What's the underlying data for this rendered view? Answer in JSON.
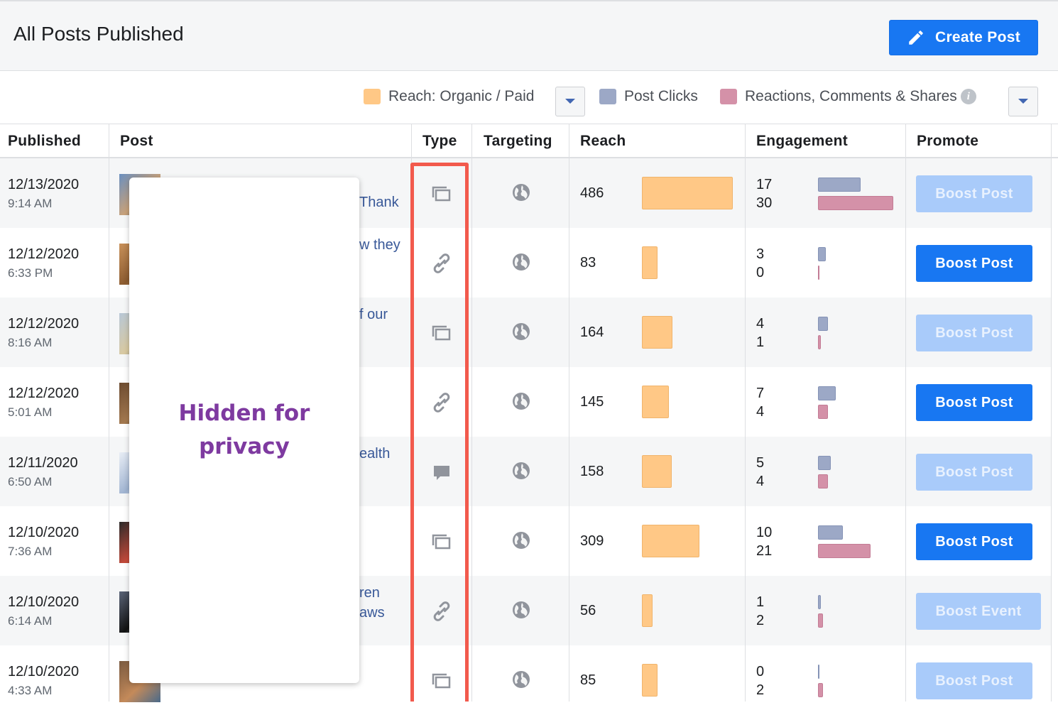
{
  "header": {
    "title": "All Posts Published",
    "create_label": "Create Post"
  },
  "legend": {
    "reach_label": "Reach: Organic / Paid",
    "clicks_label": "Post Clicks",
    "reactions_label": "Reactions, Comments & Shares",
    "colors": {
      "reach": "#ffc886",
      "clicks": "#9ca8c6",
      "reactions": "#d491a8"
    }
  },
  "columns": [
    "Published",
    "Post",
    "Type",
    "Targeting",
    "Reach",
    "Engagement",
    "Promote"
  ],
  "privacy_overlay": "Hidden for privacy",
  "rows": [
    {
      "date": "12/13/2020",
      "time": "9:14 AM",
      "snippet": [
        "Thank"
      ],
      "type": "photo-icon",
      "reach": 486,
      "clicks": 17,
      "reactions": 30,
      "promote": "Boost Post",
      "promote_enabled": false
    },
    {
      "date": "12/12/2020",
      "time": "6:33 PM",
      "snippet": [
        "w they"
      ],
      "type": "link-icon",
      "reach": 83,
      "clicks": 3,
      "reactions": 0,
      "promote": "Boost Post",
      "promote_enabled": true
    },
    {
      "date": "12/12/2020",
      "time": "8:16 AM",
      "snippet": [
        "f our"
      ],
      "type": "photo-icon",
      "reach": 164,
      "clicks": 4,
      "reactions": 1,
      "promote": "Boost Post",
      "promote_enabled": false
    },
    {
      "date": "12/12/2020",
      "time": "5:01 AM",
      "snippet": [],
      "type": "link-icon",
      "reach": 145,
      "clicks": 7,
      "reactions": 4,
      "promote": "Boost Post",
      "promote_enabled": true
    },
    {
      "date": "12/11/2020",
      "time": "6:50 AM",
      "snippet": [
        "ealth"
      ],
      "type": "status-icon",
      "reach": 158,
      "clicks": 5,
      "reactions": 4,
      "promote": "Boost Post",
      "promote_enabled": false
    },
    {
      "date": "12/10/2020",
      "time": "7:36 AM",
      "snippet": [],
      "type": "photo-icon",
      "reach": 309,
      "clicks": 10,
      "reactions": 21,
      "promote": "Boost Post",
      "promote_enabled": true
    },
    {
      "date": "12/10/2020",
      "time": "6:14 AM",
      "snippet": [
        "ren",
        "aws"
      ],
      "type": "link-icon",
      "reach": 56,
      "clicks": 1,
      "reactions": 2,
      "promote": "Boost Event",
      "promote_enabled": false
    },
    {
      "date": "12/10/2020",
      "time": "4:33 AM",
      "snippet": [],
      "type": "photo-icon",
      "reach": 85,
      "clicks": 0,
      "reactions": 2,
      "promote": "Boost Post",
      "promote_enabled": false
    }
  ]
}
